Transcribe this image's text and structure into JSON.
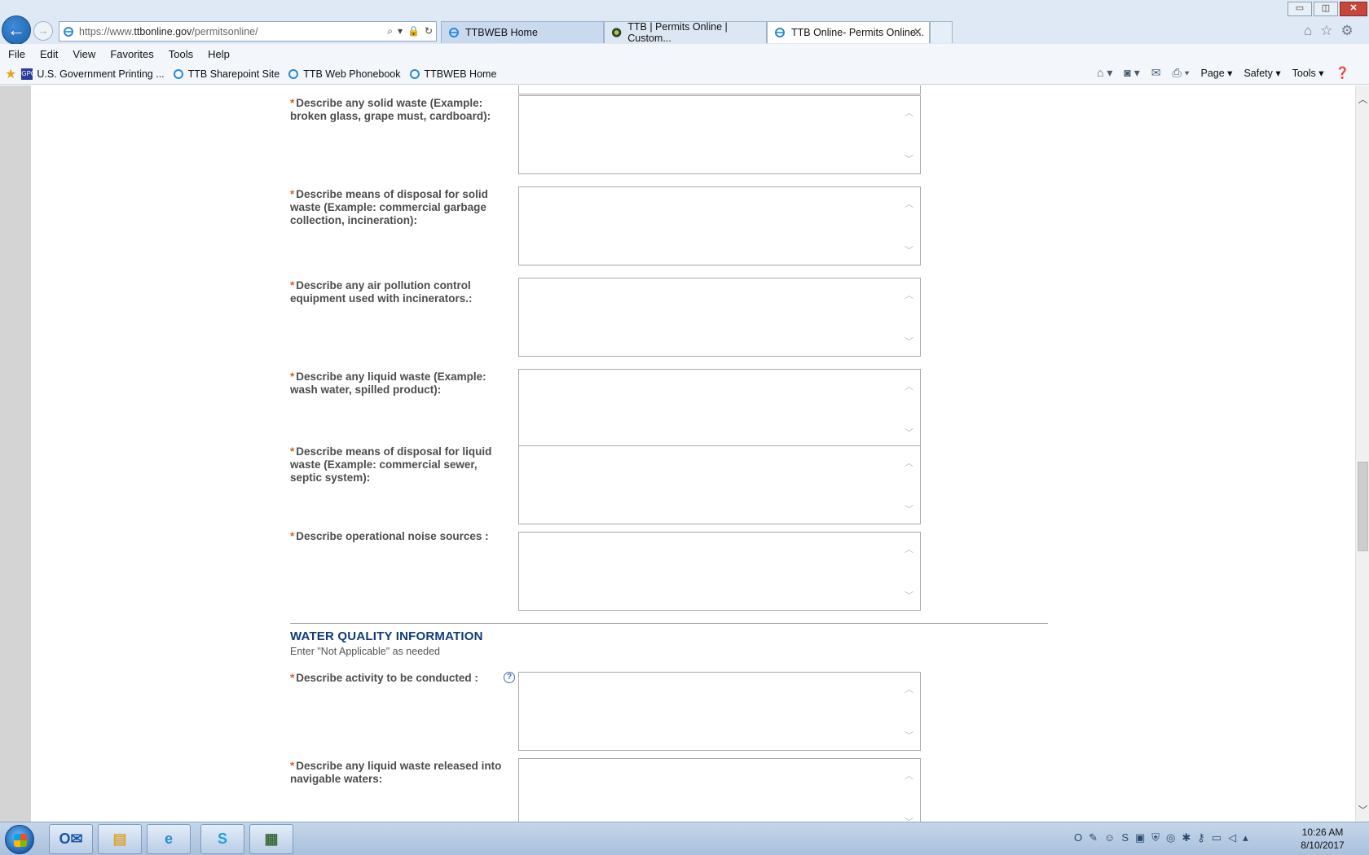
{
  "browser": {
    "url_prefix": "https://www.",
    "url_domain": "ttbonline.gov",
    "url_path": "/permitsonline/",
    "tabs": [
      {
        "label": "TTBWEB Home"
      },
      {
        "label": "TTB | Permits Online | Custom..."
      },
      {
        "label": "TTB Online- Permits Online..."
      }
    ],
    "window_controls": {
      "minimize": "▭",
      "maximize": "◫",
      "close": "✕"
    }
  },
  "menu": [
    "File",
    "Edit",
    "View",
    "Favorites",
    "Tools",
    "Help"
  ],
  "favorites": [
    {
      "label": "U.S. Government Printing ...",
      "badge": "GPO"
    },
    {
      "label": "TTB Sharepoint Site"
    },
    {
      "label": "TTB Web Phonebook"
    },
    {
      "label": "TTBWEB Home"
    }
  ],
  "command_bar": {
    "page": "Page ▾",
    "safety": "Safety ▾",
    "tools": "Tools ▾"
  },
  "form": {
    "required_marker": "*",
    "fields_env": [
      {
        "label": "Describe any solid waste (Example: broken glass, grape must, cardboard):",
        "value": ""
      },
      {
        "label": "Describe means of disposal for solid waste (Example: commercial garbage collection, incineration):",
        "value": ""
      },
      {
        "label": "Describe any air pollution control equipment used with incinerators.:",
        "value": ""
      },
      {
        "label": "Describe any liquid waste (Example: wash water, spilled product):",
        "value": ""
      },
      {
        "label": "Describe means of disposal for liquid waste (Example: commercial sewer, septic system):",
        "value": ""
      },
      {
        "label": "Describe operational noise sources :",
        "value": ""
      }
    ],
    "water_section": {
      "heading": "WATER QUALITY INFORMATION",
      "hint": "Enter \"Not Applicable\" as needed",
      "help_symbol": "?",
      "fields": [
        {
          "label": "Describe activity to be conducted :",
          "value": ""
        },
        {
          "label": "Describe any liquid waste released into navigable waters:",
          "value": ""
        }
      ]
    }
  },
  "taskbar": {
    "clock_time": "10:26 AM",
    "clock_date": "8/10/2017"
  },
  "colors": {
    "required": "#e05a1f",
    "section_heading": "#0f3c7a",
    "label_text": "#4d4d4d"
  }
}
